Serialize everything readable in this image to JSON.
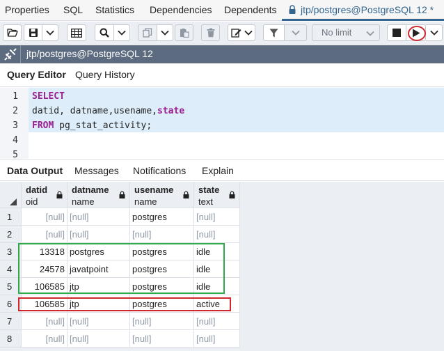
{
  "top_tabs": [
    "Properties",
    "SQL",
    "Statistics",
    "Dependencies",
    "Dependents"
  ],
  "active_tab": "jtp/postgres@PostgreSQL 12 *",
  "toolbar": {
    "limit_label": "No limit",
    "icons": [
      "folder-open-icon",
      "save-icon",
      "chevron-down-icon",
      "grid-icon",
      "search-icon",
      "chevron-down-icon",
      "copy-icon",
      "chevron-down-icon",
      "paste-icon",
      "trash-icon",
      "edit-icon",
      "chevron-down-icon",
      "filter-icon",
      "chevron-down-icon",
      "stop-icon",
      "play-icon",
      "chevron-down-icon"
    ]
  },
  "connection": {
    "title": "jtp/postgres@PostgreSQL 12"
  },
  "query_tabs": [
    "Query Editor",
    "Query History"
  ],
  "editor": {
    "lines": [
      {
        "n": "1",
        "kw": "SELECT",
        "rest": ""
      },
      {
        "n": "2",
        "kw": "",
        "rest": "datid, datname,usename,",
        "kw2": "state"
      },
      {
        "n": "3",
        "kw": "FROM",
        "rest": " pg_stat_activity;"
      },
      {
        "n": "4",
        "kw": "",
        "rest": ""
      },
      {
        "n": "5",
        "kw": "",
        "rest": ""
      }
    ]
  },
  "output_tabs": [
    "Data Output",
    "Messages",
    "Notifications",
    "Explain"
  ],
  "grid": {
    "columns": [
      {
        "name": "datid",
        "type": "oid"
      },
      {
        "name": "datname",
        "type": "name"
      },
      {
        "name": "usename",
        "type": "name"
      },
      {
        "name": "state",
        "type": "text"
      }
    ],
    "rows": [
      {
        "n": "1",
        "cells": [
          "[null]",
          "[null]",
          "postgres",
          "[null]"
        ]
      },
      {
        "n": "2",
        "cells": [
          "[null]",
          "[null]",
          "[null]",
          "[null]"
        ]
      },
      {
        "n": "3",
        "cells": [
          "13318",
          "postgres",
          "postgres",
          "idle"
        ]
      },
      {
        "n": "4",
        "cells": [
          "24578",
          "javatpoint",
          "postgres",
          "idle"
        ]
      },
      {
        "n": "5",
        "cells": [
          "106585",
          "jtp",
          "postgres",
          "idle"
        ]
      },
      {
        "n": "6",
        "cells": [
          "106585",
          "jtp",
          "postgres",
          "active"
        ]
      },
      {
        "n": "7",
        "cells": [
          "[null]",
          "[null]",
          "[null]",
          "[null]"
        ]
      },
      {
        "n": "8",
        "cells": [
          "[null]",
          "[null]",
          "[null]",
          "[null]"
        ]
      }
    ]
  },
  "colors": {
    "accent": "#326690",
    "connection_bar": "#5c6b80",
    "highlight_green": "#2faa4a",
    "highlight_red": "#d0262e",
    "keyword": "#9b1c91"
  }
}
